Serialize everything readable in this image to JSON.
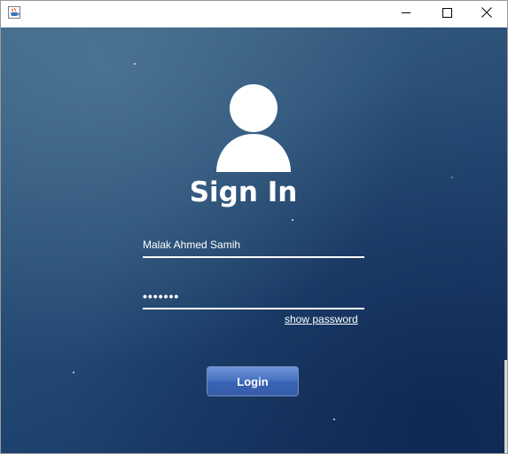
{
  "window": {
    "title": "",
    "app_icon": "java-coffee-icon",
    "controls": [
      "minimize-icon",
      "maximize-icon",
      "close-icon"
    ]
  },
  "signin": {
    "avatar_icon": "user-silhouette-icon",
    "title": "Sign In",
    "username_value": "Malak Ahmed Samih",
    "password_mask": "•••••••",
    "show_password_label": "show password",
    "login_label": "Login"
  },
  "colors": {
    "background_top": "#3d6585",
    "background_bottom": "#163563",
    "button": "#4a73c2",
    "text": "#ffffff"
  }
}
